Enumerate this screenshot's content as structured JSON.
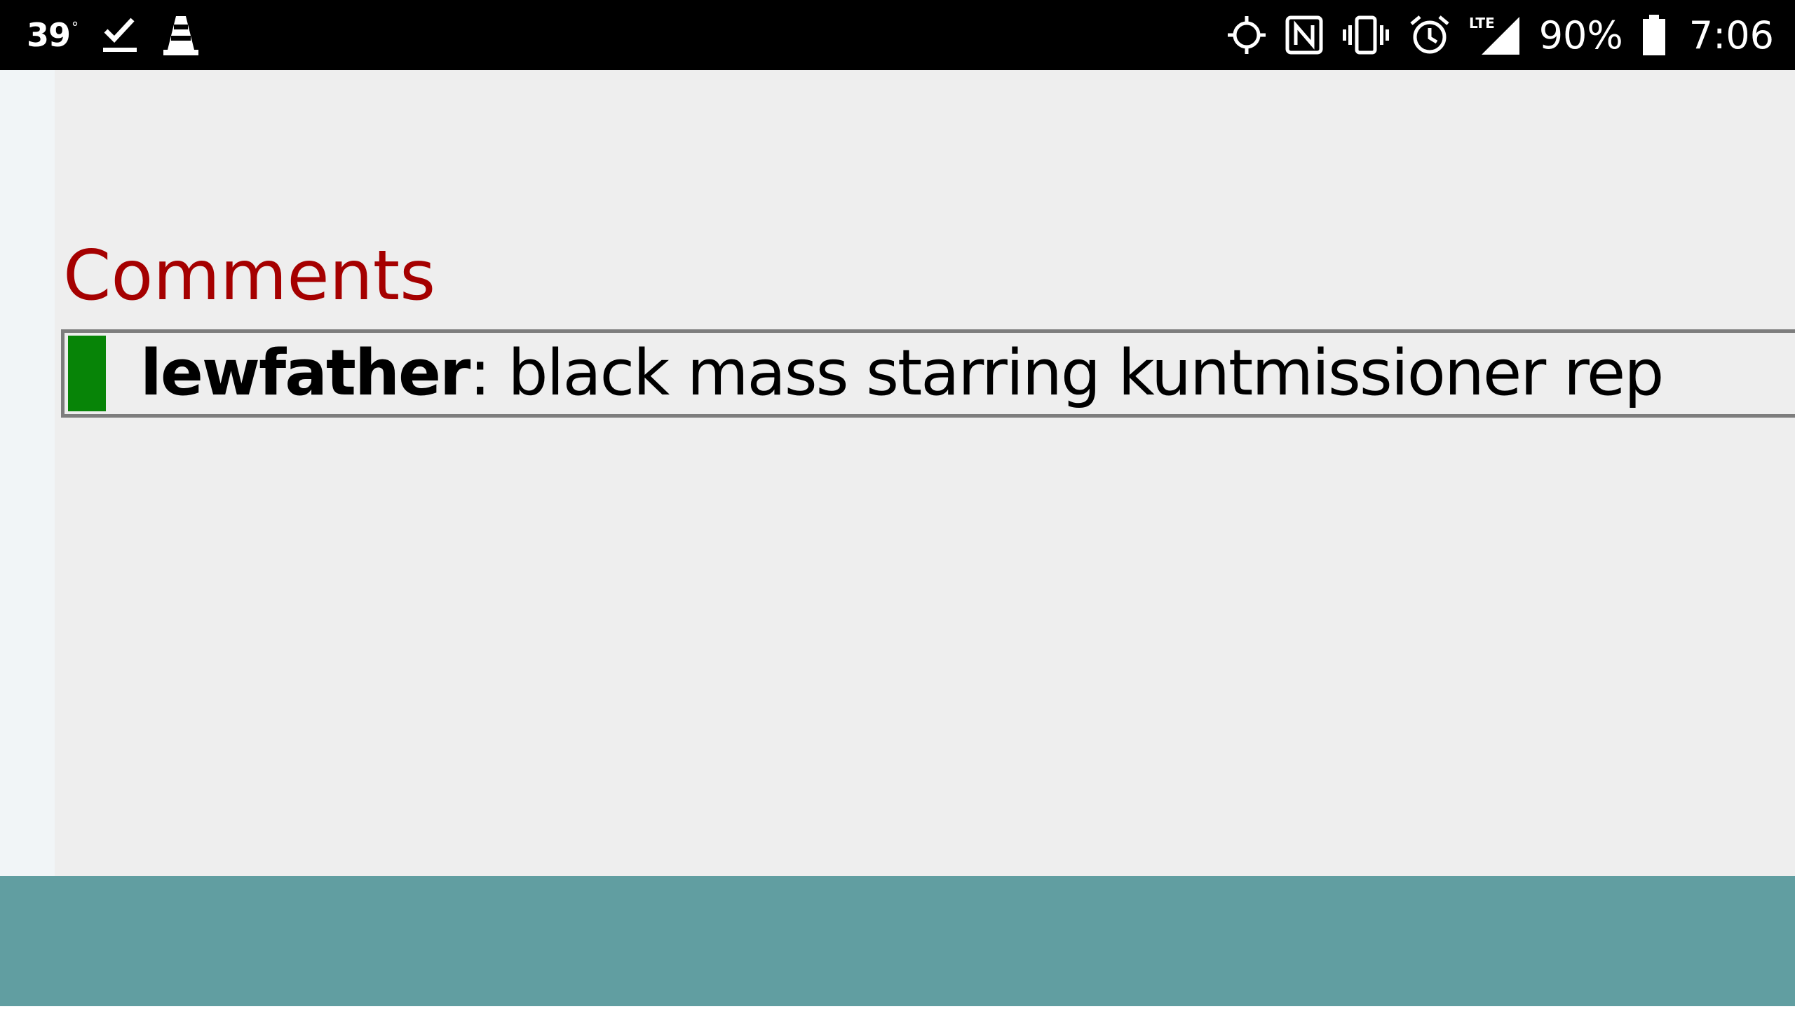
{
  "status_bar": {
    "temperature": "39",
    "temperature_unit": "°",
    "battery_percent": "90%",
    "clock": "7:06",
    "network_label": "LTE",
    "left_icons": [
      "checkmark-download-icon",
      "vlc-cone-icon"
    ],
    "right_icons": [
      "location-crosshair-icon",
      "nfc-icon",
      "vibrate-icon",
      "alarm-icon",
      "lte-signal-icon",
      "battery-icon"
    ]
  },
  "comments": {
    "heading": "Comments",
    "heading_color": "#a50000",
    "items": [
      {
        "author": "lewfather",
        "separator": ":",
        "text": " black mass starring kuntmissioner rep",
        "marker_color": "#078407"
      }
    ]
  },
  "colors": {
    "bottom_bar": "#619ea1",
    "background": "#eeeeee"
  }
}
